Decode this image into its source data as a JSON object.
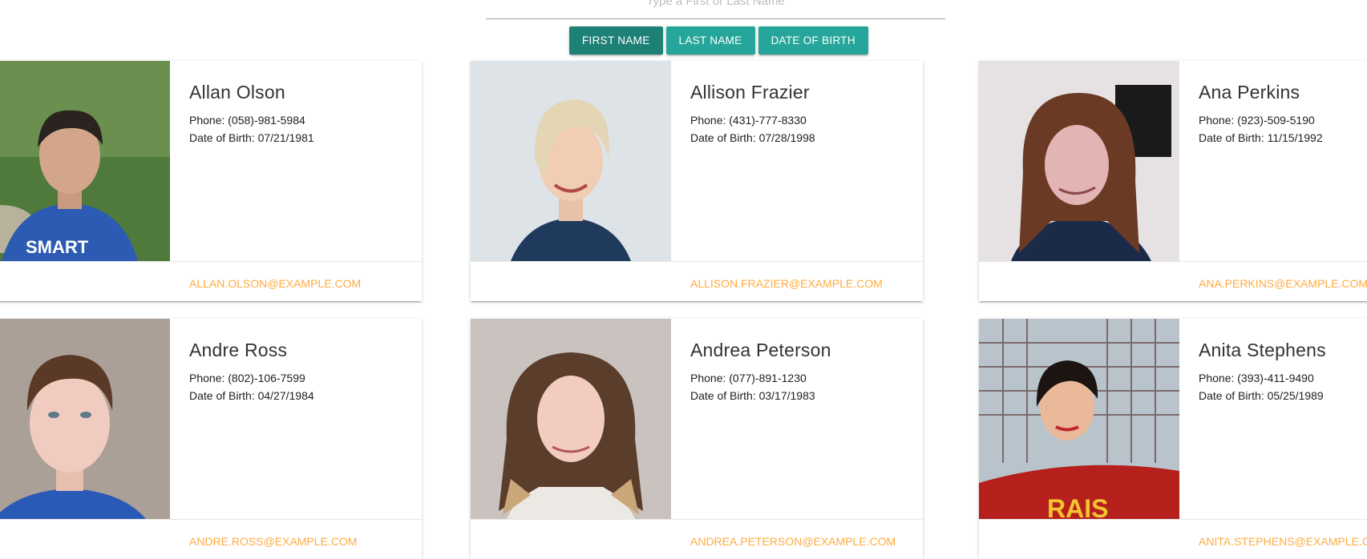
{
  "search": {
    "placeholder": "Type a First or Last Name",
    "value": ""
  },
  "sort": {
    "buttons": [
      {
        "label": "FIRST NAME",
        "active": true
      },
      {
        "label": "LAST NAME",
        "active": false
      },
      {
        "label": "DATE OF BIRTH",
        "active": false
      }
    ]
  },
  "colors": {
    "teal": "#26a69a",
    "teal_active": "#1e8176",
    "email_accent": "#ffab40"
  },
  "contacts": [
    {
      "name": "Allan Olson",
      "phone": "Phone: (058)-981-5984",
      "dob": "Date of Birth: 07/21/1981",
      "email": "ALLAN.OLSON@EXAMPLE.COM"
    },
    {
      "name": "Allison Frazier",
      "phone": "Phone: (431)-777-8330",
      "dob": "Date of Birth: 07/28/1998",
      "email": "ALLISON.FRAZIER@EXAMPLE.COM"
    },
    {
      "name": "Ana Perkins",
      "phone": "Phone: (923)-509-5190",
      "dob": "Date of Birth: 11/15/1992",
      "email": "ANA.PERKINS@EXAMPLE.COM"
    },
    {
      "name": "Andre Ross",
      "phone": "Phone: (802)-106-7599",
      "dob": "Date of Birth: 04/27/1984",
      "email": "ANDRE.ROSS@EXAMPLE.COM"
    },
    {
      "name": "Andrea Peterson",
      "phone": "Phone: (077)-891-1230",
      "dob": "Date of Birth: 03/17/1983",
      "email": "ANDREA.PETERSON@EXAMPLE.COM"
    },
    {
      "name": "Anita Stephens",
      "phone": "Phone: (393)-411-9490",
      "dob": "Date of Birth: 05/25/1989",
      "email": "ANITA.STEPHENS@EXAMPLE.COM"
    }
  ]
}
